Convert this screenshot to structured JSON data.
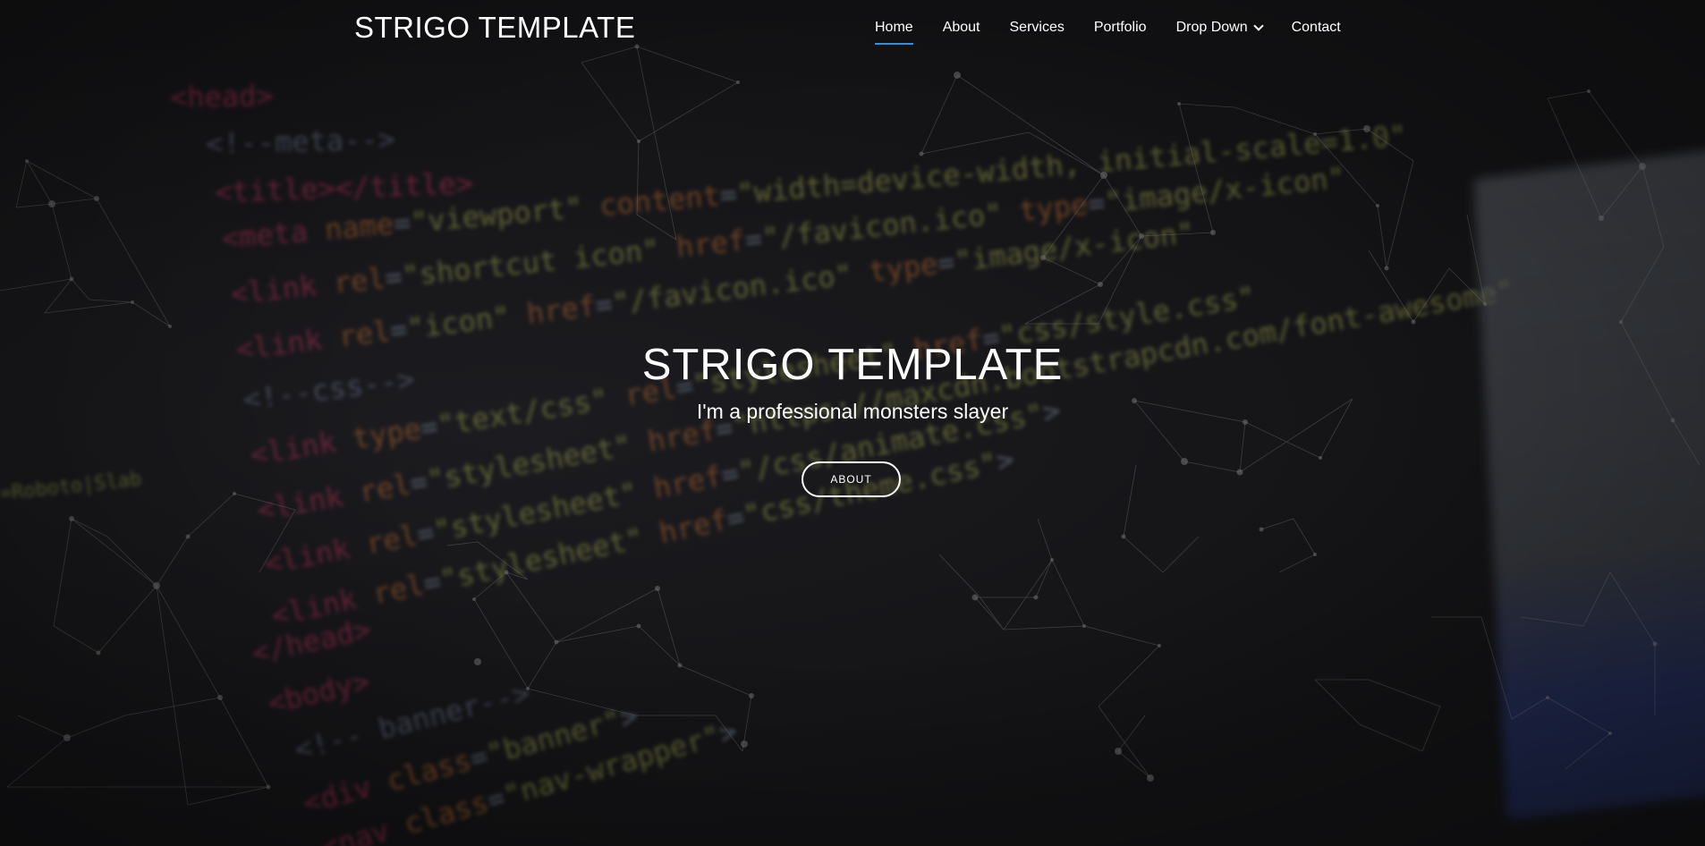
{
  "header": {
    "brand": "STRIGO TEMPLATE",
    "nav": [
      {
        "label": "Home",
        "active": true
      },
      {
        "label": "About"
      },
      {
        "label": "Services"
      },
      {
        "label": "Portfolio"
      },
      {
        "label": "Drop Down",
        "icon": "chevron-down-icon"
      },
      {
        "label": "Contact"
      }
    ]
  },
  "hero": {
    "title": "STRIGO TEMPLATE",
    "subtitle": "I'm a professional monsters slayer",
    "button_label": "ABOUT"
  },
  "colors": {
    "accent": "#2f8fe0",
    "background": "#141416",
    "text": "#ffffff"
  }
}
